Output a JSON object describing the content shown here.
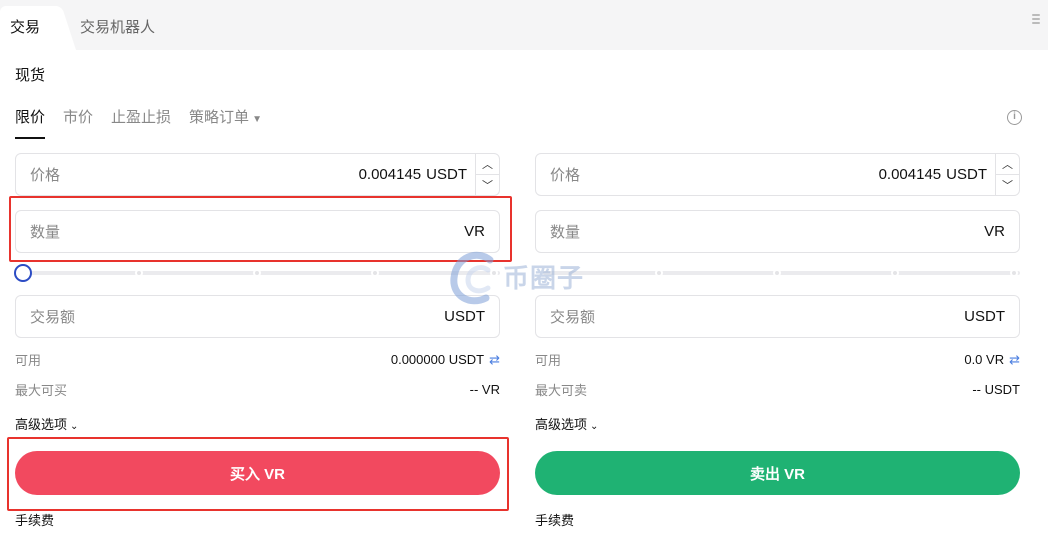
{
  "tabs": [
    {
      "label": "交易"
    },
    {
      "label": "交易机器人"
    }
  ],
  "market_label": "现货",
  "order_types": [
    {
      "label": "限价"
    },
    {
      "label": "市价"
    },
    {
      "label": "止盈止损"
    },
    {
      "label": "策略订单"
    }
  ],
  "buy": {
    "price_label": "价格",
    "price_value": "0.004145",
    "price_unit": "USDT",
    "qty_label": "数量",
    "qty_unit": "VR",
    "amount_label": "交易额",
    "amount_unit": "USDT",
    "available_label": "可用",
    "available_value": "0.000000 USDT",
    "max_label": "最大可买",
    "max_value": "-- VR",
    "advanced_label": "高级选项",
    "action_label": "买入 VR",
    "fee_label": "手续费",
    "slider_percent": 0
  },
  "sell": {
    "price_label": "价格",
    "price_value": "0.004145",
    "price_unit": "USDT",
    "qty_label": "数量",
    "qty_unit": "VR",
    "amount_label": "交易额",
    "amount_unit": "USDT",
    "available_label": "可用",
    "available_value": "0.0 VR",
    "max_label": "最大可卖",
    "max_value": "-- USDT",
    "advanced_label": "高级选项",
    "action_label": "卖出 VR",
    "fee_label": "手续费",
    "slider_percent": 0
  },
  "watermark_text": "币圈子",
  "colors": {
    "buy": "#f2495f",
    "sell": "#1fb273",
    "slider_knob": "#2c4cc4",
    "highlight": "#e8332d"
  }
}
